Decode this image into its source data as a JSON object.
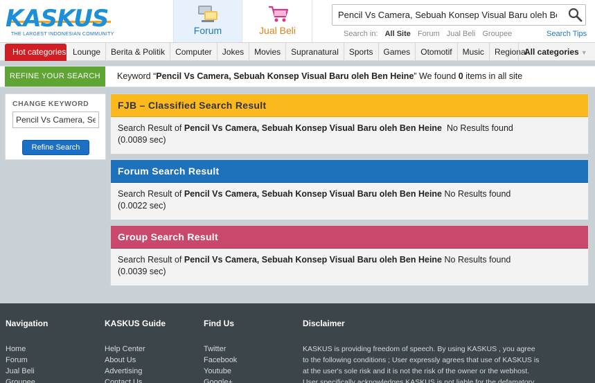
{
  "header": {
    "logo_text": "KASKUS",
    "logo_tagline": "THE LARGEST INDONESIAN COMMUNITY",
    "tabs": [
      {
        "label": "Forum",
        "icon": "forum-icon"
      },
      {
        "label": "Jual Beli",
        "icon": "shopping-cart-icon"
      }
    ],
    "search": {
      "value": "Pencil Vs Camera, Sebuah Konsep Visual Baru oleh Ben Heine",
      "search_in_label": "Search in:",
      "scopes": [
        "All Site",
        "Forum",
        "Jual Beli",
        "Groupee"
      ],
      "active_scope": "All Site",
      "tips_label": "Search Tips"
    }
  },
  "categories": {
    "hot_label": "Hot categories",
    "items": [
      "Lounge",
      "Berita & Politik",
      "Computer",
      "Jokes",
      "Movies",
      "Supranatural",
      "Sports",
      "Games",
      "Otomotif",
      "Music",
      "Regional"
    ],
    "all_label": "All categories"
  },
  "refine": {
    "label": "REFINE YOUR SEARCH",
    "keyword_prefix": "Keyword “",
    "keyword": "Pencil Vs Camera, Sebuah Konsep Visual Baru oleh Ben Heine",
    "keyword_suffix": "” We found ",
    "count": "0",
    "count_suffix": " items in all site"
  },
  "sidebar": {
    "change_label": "CHANGE KEYWORD",
    "input_value": "Pencil Vs Camera, Sebuah Konsep Visual Baru oleh Ben Heine",
    "button_label": "Refine Search"
  },
  "results": [
    {
      "title": "FJB – Classified Search Result",
      "prefix": "Search Result of ",
      "query": "Pencil Vs Camera, Sebuah Konsep Visual Baru oleh Ben Heine",
      "status": "  No Results found",
      "time": "(0.0089 sec)"
    },
    {
      "title": "Forum Search Result",
      "prefix": "Search Result of ",
      "query": "Pencil Vs Camera, Sebuah Konsep Visual Baru oleh Ben Heine",
      "status": " No Results found",
      "time": "(0.0022 sec)"
    },
    {
      "title": "Group Search Result",
      "prefix": "Search Result of ",
      "query": "Pencil Vs Camera, Sebuah Konsep Visual Baru oleh Ben Heine",
      "status": " No Results found",
      "time": "(0.0039 sec)"
    }
  ],
  "footer": {
    "navigation": {
      "title": "Navigation",
      "links": [
        "Home",
        "Forum",
        "Jual Beli",
        "Groupee"
      ]
    },
    "guide": {
      "title": "KASKUS Guide",
      "links": [
        "Help Center",
        "About Us",
        "Advertising",
        "Contact Us"
      ]
    },
    "findus": {
      "title": "Find Us",
      "links": [
        "Twitter",
        "Facebook",
        "Youtube",
        "Google+"
      ]
    },
    "disclaimer": {
      "title": "Disclaimer",
      "text": "KASKUS is providing freedom of speech. By using KASKUS , you agree to the following conditions ; User expressly agrees that use of KASKUS is at the user's sole risk and it is not the risk of the owner or the webhost. User specifically acknowledges KASKUS is not liable for the defamatory,"
    }
  }
}
